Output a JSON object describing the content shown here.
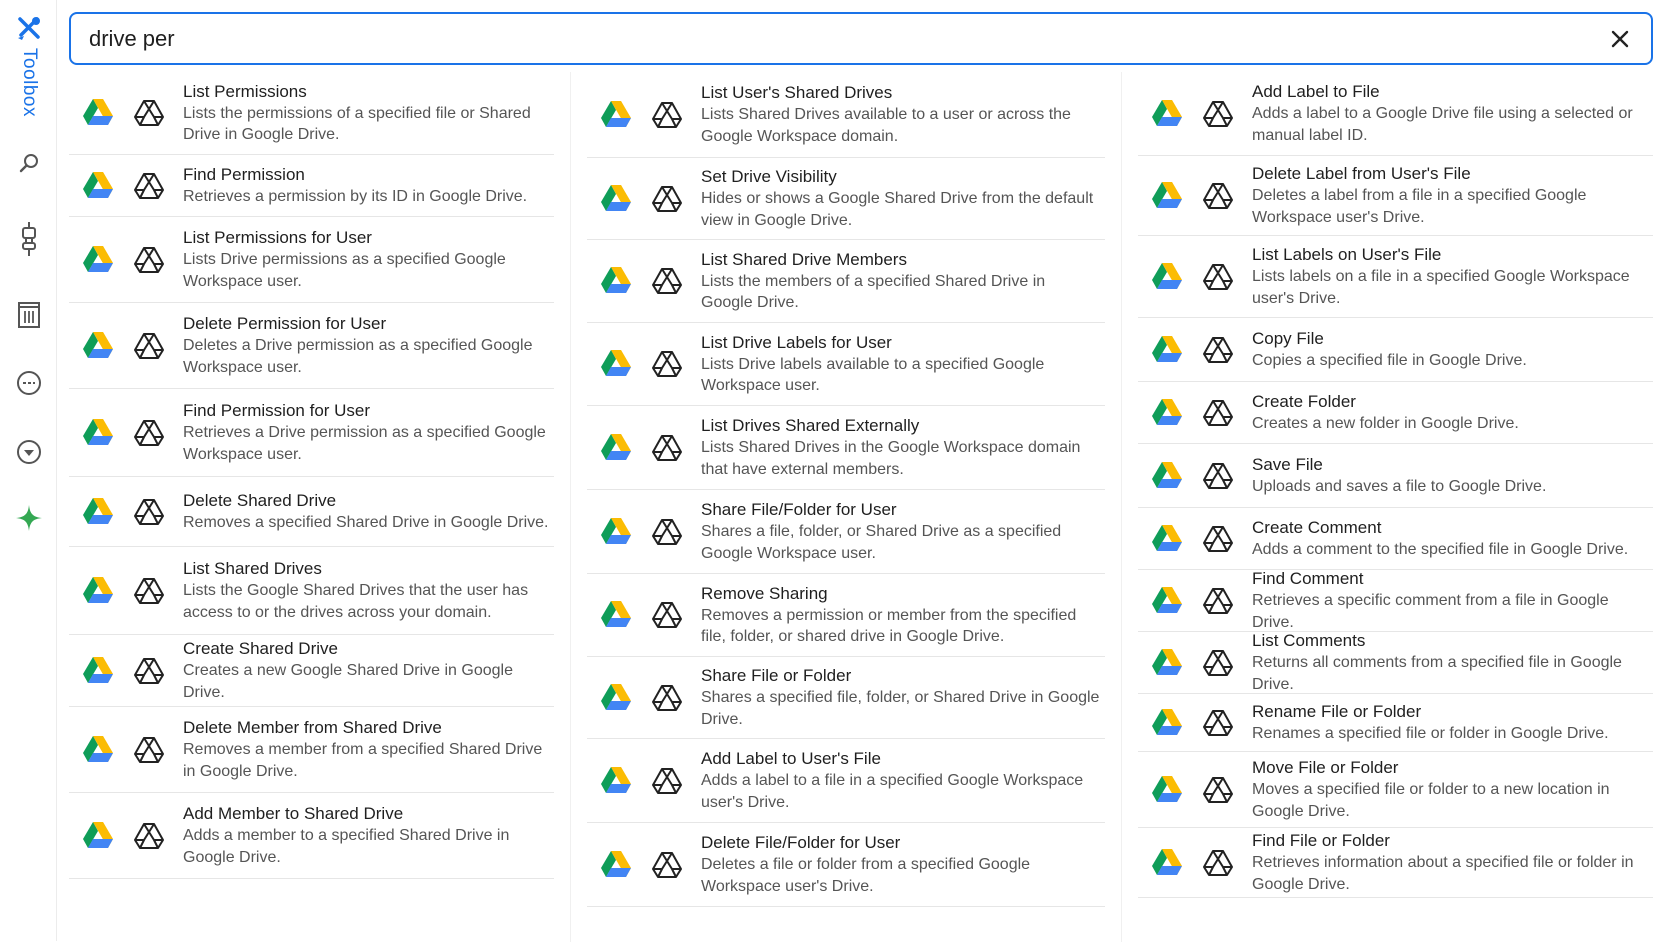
{
  "app": {
    "sidebar_label": "Toolbox"
  },
  "search": {
    "value": "drive per"
  },
  "colors": {
    "accent": "#1a73e8",
    "sparkle": "#34a853"
  },
  "sidebar_icons": [
    "tools-icon",
    "search-icon",
    "plug-icon",
    "archive-icon",
    "minus-circle-icon",
    "chevron-down-circle-icon",
    "sparkle-icon"
  ],
  "columns": [
    [
      {
        "title": "List Permissions",
        "desc": "Lists the permissions of a specified file or Shared Drive in Google Drive."
      },
      {
        "title": "Find Permission",
        "desc": "Retrieves a permission by its ID in Google Drive."
      },
      {
        "title": "List Permissions for User",
        "desc": "Lists Drive permissions as a specified Google Workspace user."
      },
      {
        "title": "Delete Permission for User",
        "desc": "Deletes a Drive permission as a specified Google Workspace user."
      },
      {
        "title": "Find Permission for User",
        "desc": "Retrieves a Drive permission as a specified Google Workspace user."
      },
      {
        "title": "Delete Shared Drive",
        "desc": "Removes a specified Shared Drive in Google Drive."
      },
      {
        "title": "List Shared Drives",
        "desc": "Lists the Google Shared Drives that the user has access to or the drives across your domain."
      },
      {
        "title": "Create Shared Drive",
        "desc": "Creates a new Google Shared Drive in Google Drive."
      },
      {
        "title": "Delete Member from Shared Drive",
        "desc": "Removes a member from a specified Shared Drive in Google Drive."
      },
      {
        "title": "Add Member to Shared Drive",
        "desc": "Adds a member to a specified Shared Drive in Google Drive."
      }
    ],
    [
      {
        "title": "List User's Shared Drives",
        "desc": "Lists Shared Drives available to a user or across the Google Workspace domain."
      },
      {
        "title": "Set Drive Visibility",
        "desc": "Hides or shows a Google Shared Drive from the default view in Google Drive."
      },
      {
        "title": "List Shared Drive Members",
        "desc": "Lists the members of a specified Shared Drive in Google Drive."
      },
      {
        "title": "List Drive Labels for User",
        "desc": "Lists Drive labels available to a specified Google Workspace user."
      },
      {
        "title": "List Drives Shared Externally",
        "desc": "Lists Shared Drives in the Google Workspace domain that have external members."
      },
      {
        "title": "Share File/Folder for User",
        "desc": "Shares a file, folder, or Shared Drive as a specified Google Workspace user."
      },
      {
        "title": "Remove Sharing",
        "desc": "Removes a permission or member from the specified file, folder, or shared drive in Google Drive."
      },
      {
        "title": "Share File or Folder",
        "desc": "Shares a specified file, folder, or Shared Drive in Google Drive."
      },
      {
        "title": "Add Label to User's File",
        "desc": "Adds a label to a file in a specified Google Workspace user's Drive."
      },
      {
        "title": "Delete File/Folder for User",
        "desc": "Deletes a file or folder from a specified Google Workspace user's Drive."
      }
    ],
    [
      {
        "title": "Add Label to File",
        "desc": "Adds a label to a Google Drive file using a selected or manual label ID."
      },
      {
        "title": "Delete Label from User's File",
        "desc": "Deletes a label from a file in a specified Google Workspace user's Drive."
      },
      {
        "title": "List Labels on User's File",
        "desc": "Lists labels on a file in a specified Google Workspace user's Drive."
      },
      {
        "title": "Copy File",
        "desc": "Copies a specified file in Google Drive."
      },
      {
        "title": "Create Folder",
        "desc": "Creates a new folder in Google Drive."
      },
      {
        "title": "Save File",
        "desc": "Uploads and saves a file to Google Drive."
      },
      {
        "title": "Create Comment",
        "desc": "Adds a comment to the specified file in Google Drive."
      },
      {
        "title": "Find Comment",
        "desc": "Retrieves a specific comment from a file in Google Drive."
      },
      {
        "title": "List Comments",
        "desc": "Returns all comments from a specified file in Google Drive."
      },
      {
        "title": "Rename File or Folder",
        "desc": "Renames a specified file or folder in Google Drive."
      },
      {
        "title": "Move File or Folder",
        "desc": "Moves a specified file or folder to a new location in Google Drive."
      },
      {
        "title": "Find File or Folder",
        "desc": "Retrieves information about a specified file or folder in Google Drive."
      }
    ]
  ]
}
